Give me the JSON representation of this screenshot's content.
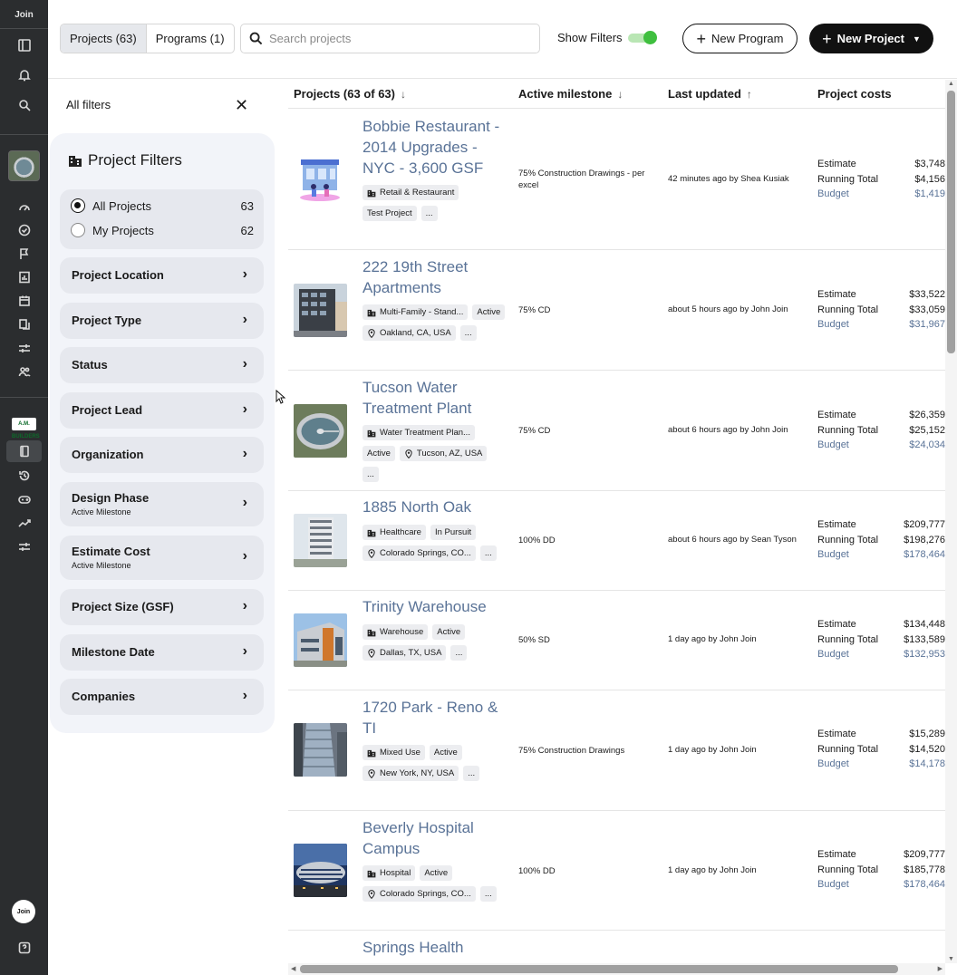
{
  "rail": {
    "brand": "Join",
    "partner_logo": "A.M. BUILDERS",
    "avatar": "Join"
  },
  "header": {
    "tabs": [
      {
        "label": "Projects (63)",
        "active": true
      },
      {
        "label": "Programs (1)",
        "active": false
      }
    ],
    "search_placeholder": "Search projects",
    "show_filters_label": "Show Filters",
    "show_filters_on": true,
    "new_program_label": "New Program",
    "new_project_label": "New Project"
  },
  "filters": {
    "header": "All filters",
    "title": "Project Filters",
    "scopes": [
      {
        "label": "All Projects",
        "count": "63",
        "selected": true
      },
      {
        "label": "My Projects",
        "count": "62",
        "selected": false
      }
    ],
    "items": [
      {
        "label": "Project Location",
        "sub": ""
      },
      {
        "label": "Project Type",
        "sub": ""
      },
      {
        "label": "Status",
        "sub": ""
      },
      {
        "label": "Project Lead",
        "sub": ""
      },
      {
        "label": "Organization",
        "sub": ""
      },
      {
        "label": "Design Phase",
        "sub": "Active Milestone"
      },
      {
        "label": "Estimate Cost",
        "sub": "Active Milestone"
      },
      {
        "label": "Project Size (GSF)",
        "sub": ""
      },
      {
        "label": "Milestone Date",
        "sub": ""
      },
      {
        "label": "Companies",
        "sub": ""
      }
    ]
  },
  "table": {
    "columns": {
      "projects": "Projects (63 of 63)",
      "milestone": "Active milestone",
      "updated": "Last updated",
      "costs": "Project costs"
    },
    "cost_labels": {
      "estimate": "Estimate",
      "running": "Running Total",
      "budget": "Budget"
    },
    "rows": [
      {
        "name": "Bobbie Restaurant - 2014 Upgrades - NYC - 3,600 GSF",
        "tags": [
          {
            "icon": "building",
            "text": "Retail & Restaurant"
          },
          {
            "icon": "",
            "text": "Test Project"
          },
          {
            "icon": "",
            "text": "..."
          }
        ],
        "milestone": "75% Construction Drawings - per excel",
        "updated": "42 minutes ago by Shea Kusiak",
        "estimate": "$3,748",
        "running": "$4,156",
        "budget": "$1,419"
      },
      {
        "name": "222 19th Street Apartments",
        "tags": [
          {
            "icon": "building",
            "text": "Multi-Family - Stand..."
          },
          {
            "icon": "",
            "text": "Active"
          },
          {
            "icon": "pin",
            "text": "Oakland, CA, USA"
          },
          {
            "icon": "",
            "text": "..."
          }
        ],
        "milestone": "75% CD",
        "updated": "about 5 hours ago by John Join",
        "estimate": "$33,522",
        "running": "$33,059",
        "budget": "$31,967"
      },
      {
        "name": "Tucson Water Treatment Plant",
        "tags": [
          {
            "icon": "building",
            "text": "Water Treatment Plan..."
          },
          {
            "icon": "",
            "text": "Active"
          },
          {
            "icon": "pin",
            "text": "Tucson, AZ, USA"
          },
          {
            "icon": "",
            "text": "..."
          }
        ],
        "milestone": "75% CD",
        "updated": "about 6 hours ago by John Join",
        "estimate": "$26,359",
        "running": "$25,152",
        "budget": "$24,034"
      },
      {
        "name": "1885 North Oak",
        "tags": [
          {
            "icon": "building",
            "text": "Healthcare"
          },
          {
            "icon": "",
            "text": "In Pursuit"
          },
          {
            "icon": "pin",
            "text": "Colorado Springs, CO..."
          },
          {
            "icon": "",
            "text": "..."
          }
        ],
        "milestone": "100% DD",
        "updated": "about 6 hours ago by Sean Tyson",
        "estimate": "$209,777",
        "running": "$198,276",
        "budget": "$178,464"
      },
      {
        "name": "Trinity Warehouse",
        "tags": [
          {
            "icon": "building",
            "text": "Warehouse"
          },
          {
            "icon": "",
            "text": "Active"
          },
          {
            "icon": "pin",
            "text": "Dallas, TX, USA"
          },
          {
            "icon": "",
            "text": "..."
          }
        ],
        "milestone": "50% SD",
        "updated": "1 day ago by John Join",
        "estimate": "$134,448",
        "running": "$133,589",
        "budget": "$132,953"
      },
      {
        "name": "1720 Park - Reno & TI",
        "tags": [
          {
            "icon": "building",
            "text": "Mixed Use"
          },
          {
            "icon": "",
            "text": "Active"
          },
          {
            "icon": "pin",
            "text": "New York, NY, USA"
          },
          {
            "icon": "",
            "text": "..."
          }
        ],
        "milestone": "75% Construction Drawings",
        "updated": "1 day ago by John Join",
        "estimate": "$15,289",
        "running": "$14,520",
        "budget": "$14,178"
      },
      {
        "name": "Beverly Hospital Campus",
        "tags": [
          {
            "icon": "building",
            "text": "Hospital"
          },
          {
            "icon": "",
            "text": "Active"
          },
          {
            "icon": "pin",
            "text": "Colorado Springs, CO..."
          },
          {
            "icon": "",
            "text": "..."
          }
        ],
        "milestone": "100% DD",
        "updated": "1 day ago by John Join",
        "estimate": "$209,777",
        "running": "$185,778",
        "budget": "$178,464"
      },
      {
        "name": "Springs Health",
        "tags": [],
        "milestone": "",
        "updated": "",
        "estimate": "",
        "running": "",
        "budget": ""
      }
    ]
  }
}
